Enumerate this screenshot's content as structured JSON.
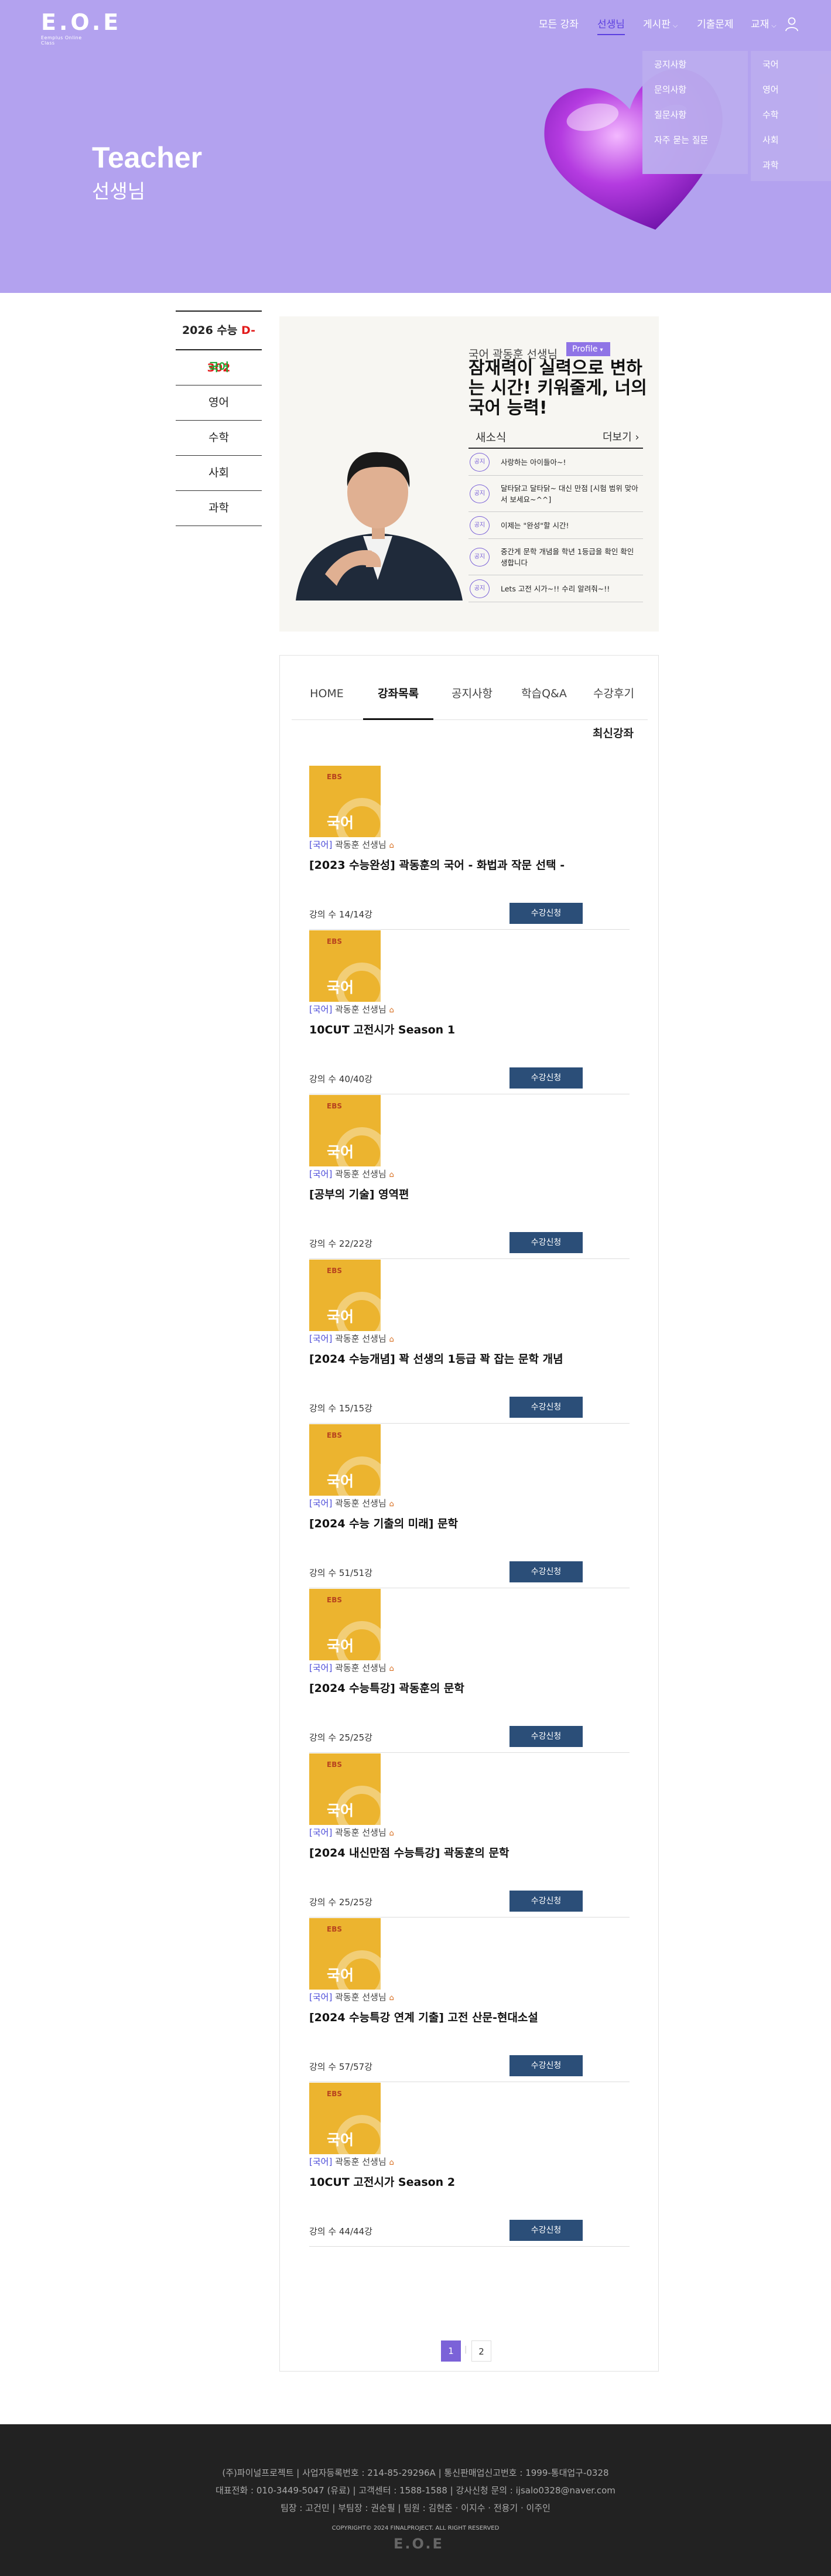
{
  "header": {
    "logo_text": "E.O.E",
    "logo_sub": "Eemplus Online Class",
    "nav": [
      {
        "label": "모든 강좌"
      },
      {
        "label": "선생님"
      },
      {
        "label": "게시판"
      },
      {
        "label": "기출문제"
      },
      {
        "label": "교재"
      }
    ],
    "board_menu": [
      "공지사항",
      "문의사항",
      "질문사항",
      "자주 묻는 질문"
    ],
    "book_menu": [
      "국어",
      "영어",
      "수학",
      "사회",
      "과학"
    ]
  },
  "hero": {
    "title": "Teacher",
    "subtitle": "선생님",
    "colors": {
      "background": "#b3a2ef",
      "accent": "#5b3fe0"
    }
  },
  "sidebar": {
    "year_label": "2026 수능",
    "dday": "D-302",
    "subjects": [
      "국어",
      "영어",
      "수학",
      "사회",
      "과학"
    ],
    "active": "국어"
  },
  "profile": {
    "teacher_name": "국어 곽동훈 선생님",
    "badge": "Profile",
    "slogan": "잠재력이 실력으로 변하는 시간! 키워줄게, 너의 국어 능력!",
    "news_title": "새소식",
    "news_more": "더보기 ›",
    "news_bubble": "공지",
    "news": [
      "사랑하는 아이들아~!",
      "달타닭고 달타닭~ 대신 만점 [시험 범위 맞아서 보세요~^^]",
      "이제는 \"완성\"할 시간!",
      "중간게 문학 개념을 학년 1등급을 확인 확인 생합니다",
      "Lets 고전 시가~!! 수리 알려줘~!!"
    ]
  },
  "tabs": [
    "HOME",
    "강좌목록",
    "공지사항",
    "학습Q&A",
    "수강후기"
  ],
  "active_tab": "강좌목록",
  "latest_label": "최신강좌",
  "course_common": {
    "thumb_ebs": "EBS",
    "thumb_subject": "국어",
    "subject_tag": "[국어]",
    "teacher": "곽동훈 선생님",
    "enroll_label": "수강신청"
  },
  "courses": [
    {
      "title": "[2023 수능완성] 곽동훈의 국어 - 화법과 작문 선택 -",
      "count": "강의 수 14/14강"
    },
    {
      "title": "10CUT 고전시가 Season 1",
      "count": "강의 수 40/40강"
    },
    {
      "title": "[공부의 기술] 영역편",
      "count": "강의 수 22/22강"
    },
    {
      "title": "[2024 수능개념] 꽉 선생의 1등급 꽉 잡는 문학 개념",
      "count": "강의 수 15/15강"
    },
    {
      "title": "[2024 수능 기출의 미래] 문학",
      "count": "강의 수 51/51강"
    },
    {
      "title": "[2024 수능특강] 곽동훈의 문학",
      "count": "강의 수 25/25강"
    },
    {
      "title": "[2024 내신만점 수능특강] 곽동훈의 문학",
      "count": "강의 수 25/25강"
    },
    {
      "title": "[2024 수능특강 연계 기출] 고전 산문-현대소설",
      "count": "강의 수 57/57강"
    },
    {
      "title": "10CUT 고전시가 Season 2",
      "count": "강의 수 44/44강"
    }
  ],
  "pagination": {
    "current": "1",
    "separator": "|",
    "next": "2"
  },
  "footer": {
    "line1": "(주)파이널프로젝트 | 사업자등록번호 : 214-85-29296A | 통신판매업신고번호 : 1999-통대업구-0328",
    "line2": "대표전화 : 010-3449-5047 (유료) | 고객센터 : 1588-1588 | 강사신청 문의 : ijsalo0328@naver.com",
    "line3": "팀장 : 고건민  |  부팀장 : 권순필  |  팀원 : 김현준 · 이지수 · 전용기 · 이주인",
    "copyright": "COPYRIGHT© 2024 FINALPROJECT. ALL RIGHT RESERVED",
    "logo_text": "E.O.E"
  }
}
